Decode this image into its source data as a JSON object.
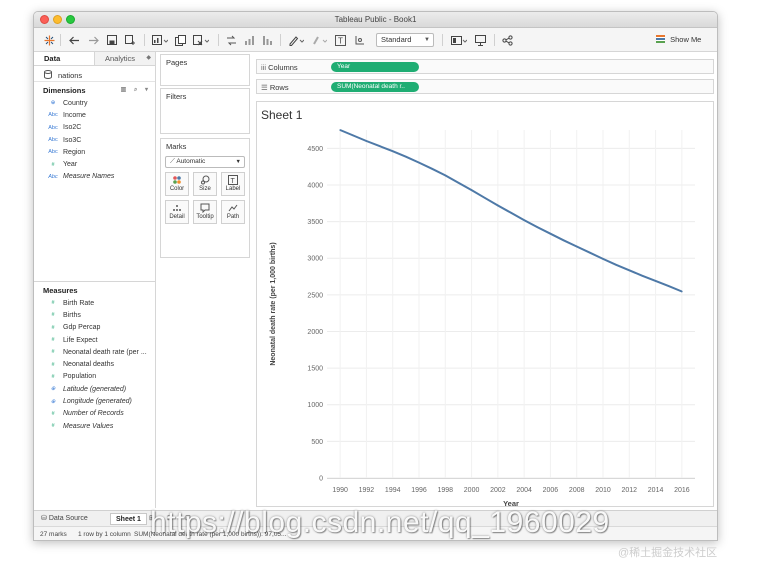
{
  "window": {
    "title": "Tableau Public - Book1"
  },
  "toolbar": {
    "fit_select": "Standard",
    "show_me_label": "Show Me"
  },
  "left_pane": {
    "tabs": [
      {
        "label": "Data"
      },
      {
        "label": "Analytics"
      }
    ],
    "datasource": "nations",
    "dimensions_header": "Dimensions",
    "dimensions": [
      {
        "icon": "globe-icon",
        "label": "Country",
        "italic": false
      },
      {
        "icon": "abc-icon",
        "label": "Income",
        "italic": false
      },
      {
        "icon": "abc-icon",
        "label": "Iso2C",
        "italic": false
      },
      {
        "icon": "abc-icon",
        "label": "Iso3C",
        "italic": false
      },
      {
        "icon": "abc-icon",
        "label": "Region",
        "italic": false
      },
      {
        "icon": "number-icon",
        "label": "Year",
        "italic": false
      },
      {
        "icon": "abc-icon",
        "label": "Measure Names",
        "italic": true
      }
    ],
    "measures_header": "Measures",
    "measures": [
      {
        "icon": "number-icon",
        "label": "Birth Rate",
        "italic": false
      },
      {
        "icon": "number-icon",
        "label": "Births",
        "italic": false
      },
      {
        "icon": "number-icon",
        "label": "Gdp Percap",
        "italic": false
      },
      {
        "icon": "number-icon",
        "label": "Life Expect",
        "italic": false
      },
      {
        "icon": "number-icon",
        "label": "Neonatal death rate (per ...",
        "italic": false
      },
      {
        "icon": "number-icon",
        "label": "Neonatal deaths",
        "italic": false
      },
      {
        "icon": "number-icon",
        "label": "Population",
        "italic": false
      },
      {
        "icon": "globe-icon",
        "label": "Latitude (generated)",
        "italic": true
      },
      {
        "icon": "globe-icon",
        "label": "Longitude (generated)",
        "italic": true
      },
      {
        "icon": "number-icon",
        "label": "Number of Records",
        "italic": true
      },
      {
        "icon": "number-icon",
        "label": "Measure Values",
        "italic": true
      }
    ]
  },
  "cards": {
    "pages": "Pages",
    "filters": "Filters",
    "marks": "Marks",
    "mark_type": "Automatic",
    "mark_buttons": [
      "Color",
      "Size",
      "Label",
      "Detail",
      "Tooltip",
      "Path"
    ]
  },
  "shelves": {
    "columns_label": "Columns",
    "columns_pill": "Year",
    "rows_label": "Rows",
    "rows_pill": "SUM(Neonatal death r.."
  },
  "sheet": {
    "title": "Sheet 1"
  },
  "chart_data": {
    "type": "line",
    "xlabel": "Year",
    "ylabel": "Neonatal death rate (per 1,000 births)",
    "x_ticks": [
      "1990",
      "1992",
      "1994",
      "1996",
      "1998",
      "2000",
      "2002",
      "2004",
      "2006",
      "2008",
      "2010",
      "2012",
      "2014",
      "2016"
    ],
    "y_ticks": [
      "0",
      "500",
      "1000",
      "1500",
      "2000",
      "2500",
      "3000",
      "3500",
      "4000",
      "4500"
    ],
    "xlim": [
      1989,
      2017
    ],
    "ylim": [
      0,
      4750
    ],
    "grid": true,
    "color": "#4e79a7",
    "series": [
      {
        "x": [
          1990,
          1991,
          1992,
          1993,
          1994,
          1995,
          1996,
          1997,
          1998,
          1999,
          2000,
          2001,
          2002,
          2003,
          2004,
          2005,
          2006,
          2007,
          2008,
          2009,
          2010,
          2011,
          2012,
          2013,
          2014,
          2015,
          2016
        ],
        "values": [
          4750,
          4675,
          4600,
          4530,
          4460,
          4385,
          4305,
          4220,
          4130,
          4030,
          3930,
          3825,
          3720,
          3620,
          3520,
          3425,
          3335,
          3245,
          3160,
          3075,
          2990,
          2910,
          2835,
          2760,
          2690,
          2620,
          2545
        ]
      }
    ]
  },
  "bottom_tabs": {
    "data_source": "Data Source",
    "sheet": "Sheet 1"
  },
  "status_bar": {
    "marks": "27 marks",
    "rows_cols": "1 row by 1 column",
    "sum": "SUM(Neonatal death rate (per 1,000 births)): 97,05..."
  },
  "watermark": {
    "url": "https://blog.csdn.net/qq_1960029",
    "site": "@稀土掘金技术社区"
  }
}
